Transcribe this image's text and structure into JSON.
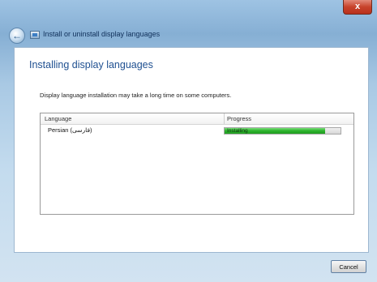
{
  "window": {
    "title": "Install or uninstall display languages",
    "close_label": "x"
  },
  "main": {
    "heading": "Installing display languages",
    "description": "Display language installation may take a long time on some computers."
  },
  "list": {
    "columns": [
      "Language",
      "Progress"
    ],
    "rows": [
      {
        "language": "Persian (فارسی)",
        "status": "Installing",
        "progress": 0.87
      }
    ]
  },
  "footer": {
    "cancel_label": "Cancel"
  },
  "colors": {
    "heading": "#1e4f90",
    "progress_fill": "#2fb52f"
  },
  "icons": {
    "back": "back-arrow-icon",
    "app": "language-window-icon",
    "close": "close-icon"
  }
}
